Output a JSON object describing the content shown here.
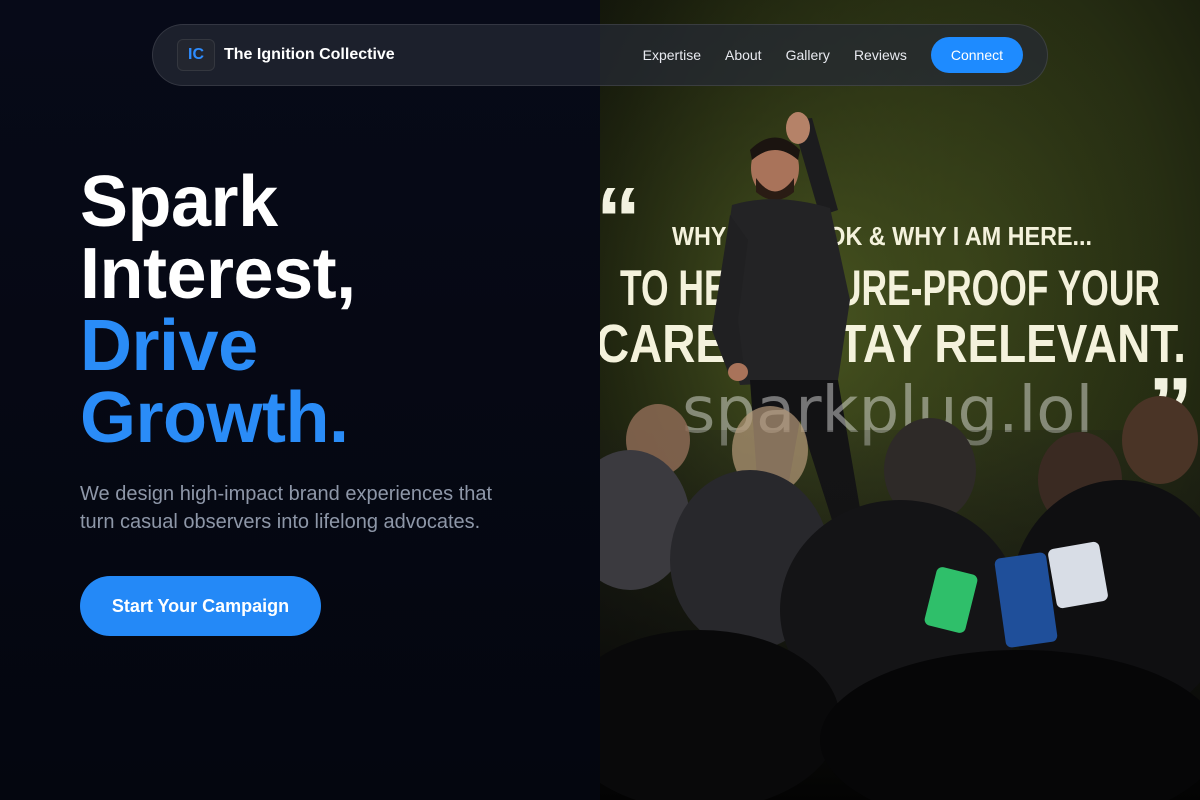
{
  "nav": {
    "brand_initials": "IC",
    "brand_name": "The Ignition Collective",
    "links": [
      "Expertise",
      "About",
      "Gallery",
      "Reviews"
    ],
    "cta_label": "Connect"
  },
  "hero": {
    "headline_lines": [
      "Spark",
      "Interest,"
    ],
    "headline_accent_lines": [
      "Drive",
      "Growth."
    ],
    "subtitle": "We design high-impact brand experiences that turn casual observers into lifelong advocates.",
    "cta_label": "Start Your Campaign"
  },
  "photo": {
    "screen_line_1": "WHY I W... BOOK & WHY I AM HERE...",
    "screen_line_2": "TO HEL... UTURE-PROOF YOUR",
    "screen_line_3": "CAREE... STAY RELEVANT.",
    "watermark": "sparkplug.lol"
  },
  "colors": {
    "accent": "#2a8cf7",
    "background": "#050814",
    "subtitle": "#8e97a8"
  }
}
